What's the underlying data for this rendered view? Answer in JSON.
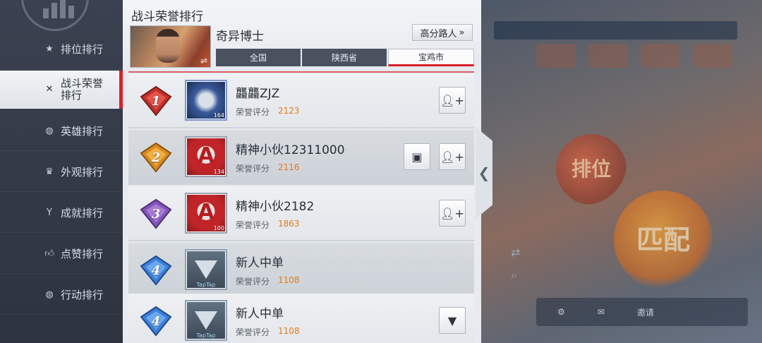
{
  "sidebar": {
    "items": [
      {
        "label": "排位排行",
        "icon": "star-icon"
      },
      {
        "label": "战斗荣誉排行",
        "icon": "swords-icon"
      },
      {
        "label": "英雄排行",
        "icon": "hero-emblem-icon"
      },
      {
        "label": "外观排行",
        "icon": "shirt-icon"
      },
      {
        "label": "成就排行",
        "icon": "trophy-icon"
      },
      {
        "label": "点赞排行",
        "icon": "thumbs-up-icon"
      },
      {
        "label": "行动排行",
        "icon": "action-emblem-icon"
      }
    ],
    "active_index": 1
  },
  "panel": {
    "title": "战斗荣誉排行",
    "hero_name": "奇异博士",
    "high_score_button": "高分路人",
    "tabs": [
      "全国",
      "陕西省",
      "宝鸡市"
    ],
    "active_tab": "宝鸡市"
  },
  "rankings": [
    {
      "rank": "1",
      "badge_color": "#c0302c",
      "name": "龘龘ZJZ",
      "score_label": "荣誉评分",
      "score": "2123",
      "avatar_level": "164",
      "avatar": "gundam"
    },
    {
      "rank": "2",
      "badge_color": "#d98a22",
      "name": "精神小伙12311000",
      "score_label": "荣誉评分",
      "score": "2116",
      "avatar_level": "134",
      "avatar": "avengers"
    },
    {
      "rank": "3",
      "badge_color": "#8455b8",
      "name": "精神小伙2182",
      "score_label": "荣誉评分",
      "score": "1863",
      "avatar_level": "100",
      "avatar": "avengers"
    },
    {
      "rank": "4",
      "badge_color": "#3c7fd9",
      "name": "新人中单",
      "score_label": "荣誉评分",
      "score": "1108",
      "avatar_level": "TapTap",
      "avatar": "taptap"
    },
    {
      "rank": "4",
      "badge_color": "#3c7fd9",
      "name": "新人中单",
      "score_label": "荣誉评分",
      "score": "1108",
      "avatar_level": "TapTap",
      "avatar": "taptap"
    }
  ],
  "background": {
    "bubble1": "排位",
    "bubble2": "匹配",
    "bottom_text": "邀请"
  },
  "colors": {
    "accent_red": "#d8202a",
    "score_orange": "#e07b1b"
  }
}
